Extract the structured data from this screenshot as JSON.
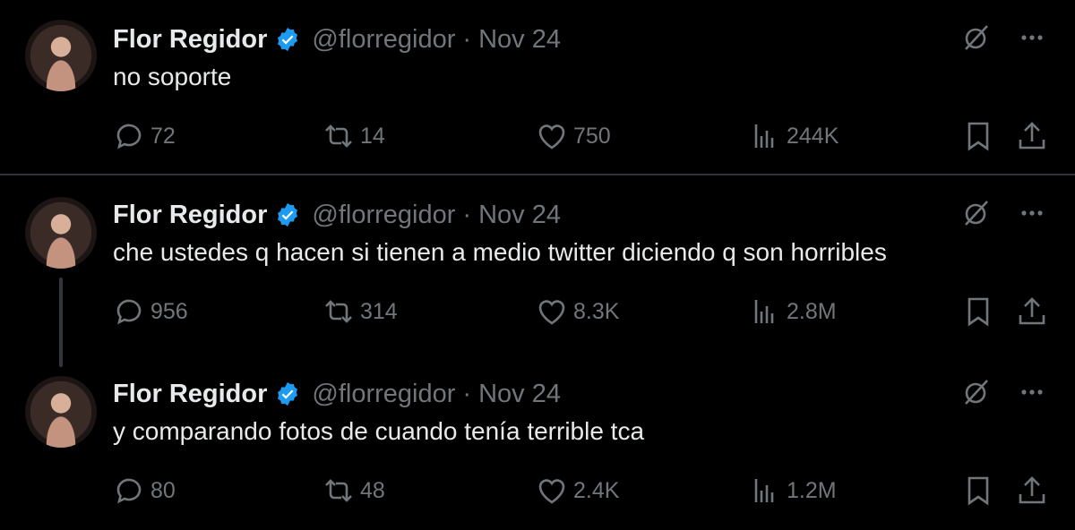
{
  "tweets": [
    {
      "name": "Flor Regidor",
      "handle": "@florregidor",
      "separator": "·",
      "date": "Nov 24",
      "text": "no soporte",
      "replies": "72",
      "retweets": "14",
      "likes": "750",
      "views": "244K"
    },
    {
      "name": "Flor Regidor",
      "handle": "@florregidor",
      "separator": "·",
      "date": "Nov 24",
      "text": "che ustedes q hacen si tienen a medio twitter diciendo q son horribles",
      "replies": "956",
      "retweets": "314",
      "likes": "8.3K",
      "views": "2.8M"
    },
    {
      "name": "Flor Regidor",
      "handle": "@florregidor",
      "separator": "·",
      "date": "Nov 24",
      "text": "y comparando fotos de cuando tenía terrible tca",
      "replies": "80",
      "retweets": "48",
      "likes": "2.4K",
      "views": "1.2M"
    }
  ],
  "icons": {
    "verified": "verified-badge-icon",
    "grok": "grok-icon",
    "more": "more-icon",
    "reply": "reply-icon",
    "retweet": "retweet-icon",
    "like": "heart-icon",
    "views": "views-icon",
    "bookmark": "bookmark-icon",
    "share": "share-icon"
  },
  "colors": {
    "background": "#000000",
    "text": "#e7e9ea",
    "secondary": "#71767b",
    "verified": "#1d9bf0",
    "divider": "#2f3336"
  }
}
